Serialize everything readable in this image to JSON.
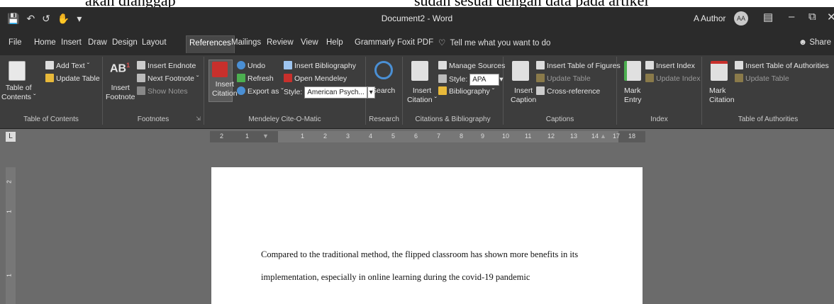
{
  "top_overflow": {
    "left_text": "akan dianggap",
    "right_text": "sudah sesuai dengan data pada artikel"
  },
  "titlebar": {
    "title": "Document2 - Word",
    "user": "A Author",
    "avatar_initials": "AA",
    "qat_icons": [
      "save-icon",
      "undo-icon",
      "redo-icon",
      "touch-mode-icon",
      "customize-qat-icon"
    ]
  },
  "tabs": [
    "File",
    "Home",
    "Insert",
    "Draw",
    "Design",
    "Layout",
    "References",
    "Mailings",
    "Review",
    "View",
    "Help",
    "Grammarly",
    "Foxit PDF"
  ],
  "active_tab": "References",
  "tell_me": "Tell me what you want to do",
  "share": "Share",
  "ribbon": {
    "toc": {
      "big": "Table of",
      "big2": "Contents",
      "add_text": "Add Text",
      "update_table": "Update Table",
      "label": "Table of Contents"
    },
    "footnotes": {
      "insert_endnote": "Insert Endnote",
      "next_footnote": "Next Footnote",
      "show_notes": "Show Notes",
      "insert": "Insert",
      "footnote": "Footnote",
      "ab": "AB",
      "label": "Footnotes"
    },
    "mendeley": {
      "insert": "Insert",
      "citation": "Citation",
      "undo": "Undo",
      "refresh": "Refresh",
      "export_as": "Export as",
      "insert_bibliography": "Insert Bibliography",
      "open_mendeley": "Open Mendeley",
      "style_label": "Style:",
      "style_value": "American Psych...",
      "label": "Mendeley Cite-O-Matic"
    },
    "research": {
      "search": "Search",
      "label": "Research"
    },
    "citations": {
      "insert": "Insert",
      "citation": "Citation",
      "manage_sources": "Manage Sources",
      "style_label": "Style:",
      "style_value": "APA",
      "bibliography": "Bibliography",
      "label": "Citations & Bibliography"
    },
    "captions": {
      "insert": "Insert",
      "caption": "Caption",
      "insert_tof": "Insert Table of Figures",
      "update_table": "Update Table",
      "cross_reference": "Cross-reference",
      "label": "Captions"
    },
    "index": {
      "mark": "Mark",
      "entry": "Entry",
      "insert_index": "Insert Index",
      "update_index": "Update Index",
      "label": "Index"
    },
    "toa": {
      "mark": "Mark",
      "citation": "Citation",
      "insert_toa": "Insert Table of Authorities",
      "update_table": "Update Table",
      "label": "Table of Authorities"
    }
  },
  "ruler": {
    "ticks": [
      "2",
      "1",
      "1",
      "2",
      "3",
      "4",
      "5",
      "6",
      "7",
      "8",
      "9",
      "10",
      "11",
      "12",
      "13",
      "14",
      "15",
      "17",
      "18"
    ],
    "corner": "L"
  },
  "vruler": [
    "2",
    "1",
    "1"
  ],
  "document": {
    "line1": "Compared to the traditional method, the flipped classroom has shown more benefits in its",
    "line2": "implementation, especially in online learning during the covid-19 pandemic"
  }
}
